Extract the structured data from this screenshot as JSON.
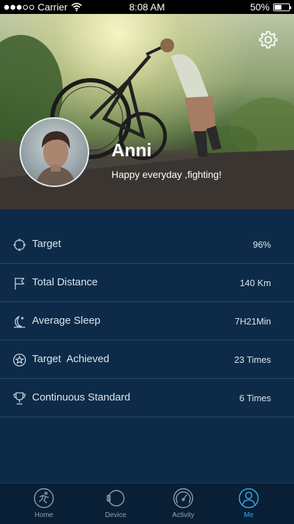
{
  "status_bar": {
    "carrier": "Carrier",
    "time": "8:08 AM",
    "battery": "50%",
    "battery_level": 0.5,
    "signal_bars_filled": 3,
    "signal_bars_total": 5
  },
  "profile": {
    "name": "Anni",
    "motto": "Happy everyday ,fighting!",
    "settings_icon": "gear-icon"
  },
  "stats": [
    {
      "icon": "target-icon",
      "label": "Target",
      "value": "96%"
    },
    {
      "icon": "flag-icon",
      "label": "Total Distance",
      "value": "140 Km"
    },
    {
      "icon": "moon-icon",
      "label": "Average Sleep",
      "value": "7H21Min"
    },
    {
      "icon": "star-icon",
      "label": "Target  Achieved",
      "value": "23 Times"
    },
    {
      "icon": "trophy-icon",
      "label": "Continuous Standard",
      "value": "6 Times"
    }
  ],
  "tabbar": {
    "items": [
      {
        "label": "Home",
        "icon": "runner-icon",
        "active": false
      },
      {
        "label": "Device",
        "icon": "watch-icon",
        "active": false
      },
      {
        "label": "Activity",
        "icon": "gauge-icon",
        "active": false
      },
      {
        "label": "Me",
        "icon": "user-icon",
        "active": true
      }
    ],
    "active_color": "#3ea9ef",
    "inactive_color": "#8ea3b6"
  },
  "colors": {
    "background": "#0d2b48",
    "divider": "#2c4a66",
    "tabbar_bg": "#091f35"
  }
}
